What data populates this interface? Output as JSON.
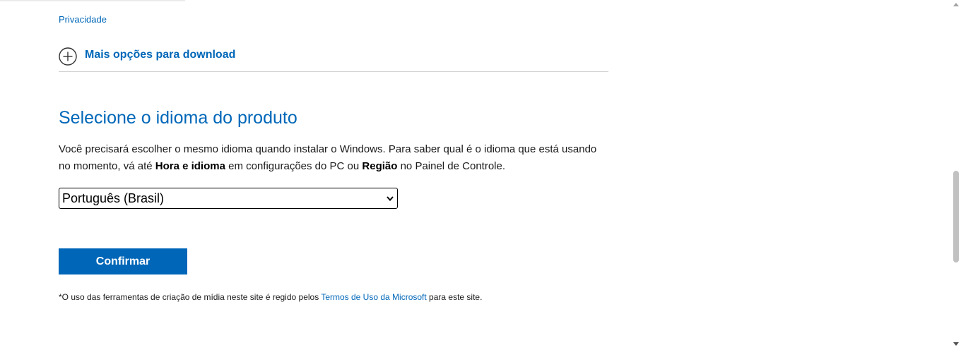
{
  "links": {
    "privacy": "Privacidade"
  },
  "more_options": {
    "label": "Mais opções para download",
    "icon": "plus-circle-icon"
  },
  "language_section": {
    "title": "Selecione o idioma do produto",
    "desc_part1": "Você precisará escolher o mesmo idioma quando instalar o Windows. Para saber qual é o idioma que está usando no momento, vá até ",
    "desc_bold1": "Hora e idioma",
    "desc_part2": " em configurações do PC ou ",
    "desc_bold2": "Região",
    "desc_part3": " no Painel de Controle.",
    "select_value": "Português (Brasil)",
    "confirm_label": "Confirmar"
  },
  "footnote": {
    "prefix": "*O uso das ferramentas de criação de mídia neste site é regido pelos ",
    "link": "Termos de Uso da Microsoft",
    "suffix": " para este site."
  },
  "colors": {
    "accent": "#0067b8",
    "divider": "#d2d2d2"
  }
}
